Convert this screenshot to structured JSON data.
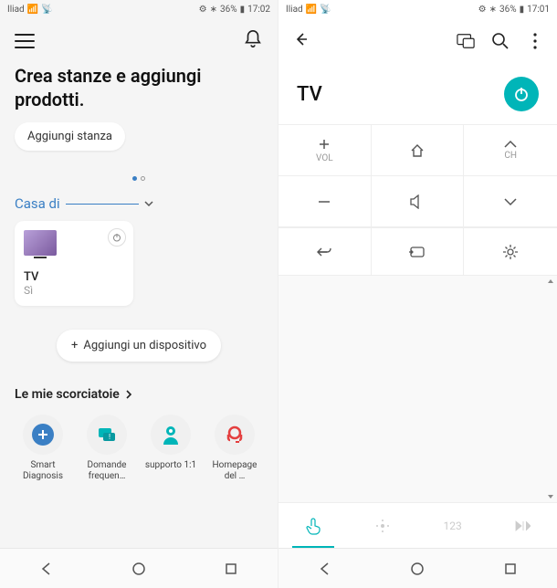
{
  "left": {
    "status": {
      "carrier": "Iliad",
      "battery": "36%",
      "time": "17:02"
    },
    "title": "Crea stanze e aggiungi prodotti.",
    "add_room": "Aggiungi stanza",
    "house_label": "Casa di",
    "device": {
      "name": "TV",
      "status": "Sì"
    },
    "add_device": "Aggiungi un dispositivo",
    "shortcuts_title": "Le mie scorciatoie",
    "shortcuts": [
      {
        "label": "Smart Diagnosis",
        "icon": "plus-badge",
        "color": "#3a7fc4"
      },
      {
        "label": "Domande frequen…",
        "icon": "chat",
        "color": "#00b5b8"
      },
      {
        "label": "supporto 1:1",
        "icon": "person-q",
        "color": "#00b5b8"
      },
      {
        "label": "Homepage del …",
        "icon": "headset",
        "color": "#e43f3f"
      }
    ]
  },
  "right": {
    "status": {
      "carrier": "Iliad",
      "battery": "36%",
      "time": "17:01"
    },
    "title": "TV",
    "vol_label": "VOL",
    "ch_label": "CH",
    "tab_123": "123"
  }
}
